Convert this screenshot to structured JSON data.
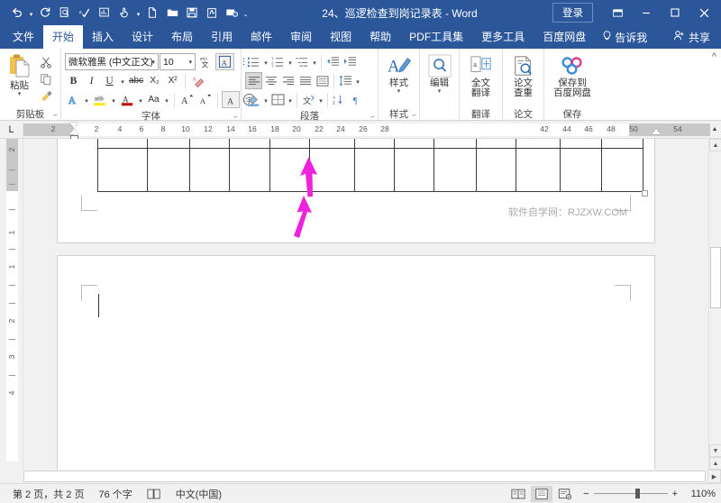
{
  "titlebar": {
    "document_title": "24、巡逻检查到岗记录表  -  Word",
    "signin_label": "登录",
    "quick_access": [
      {
        "name": "undo-icon",
        "glyph": "↶"
      },
      {
        "name": "redo-icon",
        "glyph": "↻"
      },
      {
        "name": "print-preview-icon",
        "glyph": "▣"
      },
      {
        "name": "spelling-check-icon",
        "glyph": "✓"
      },
      {
        "name": "chart-edit-icon",
        "glyph": "▤"
      },
      {
        "name": "touch-mode-icon",
        "glyph": "☝"
      },
      {
        "name": "new-document-icon",
        "glyph": "🗋"
      },
      {
        "name": "open-folder-icon",
        "glyph": "🗀"
      },
      {
        "name": "save-icon",
        "glyph": "🖫"
      },
      {
        "name": "signature-icon",
        "glyph": "🖎"
      },
      {
        "name": "email-icon",
        "glyph": "🖃"
      },
      {
        "name": "customize-qat-icon",
        "glyph": "⌄"
      }
    ],
    "window_controls": {
      "ribbon_display": "▭",
      "minimize": "—",
      "maximize": "▢",
      "close": "✕"
    }
  },
  "tabs": [
    {
      "id": "file",
      "label": "文件"
    },
    {
      "id": "home",
      "label": "开始"
    },
    {
      "id": "insert",
      "label": "插入"
    },
    {
      "id": "design",
      "label": "设计"
    },
    {
      "id": "layout",
      "label": "布局"
    },
    {
      "id": "references",
      "label": "引用"
    },
    {
      "id": "mailings",
      "label": "邮件"
    },
    {
      "id": "review",
      "label": "审阅"
    },
    {
      "id": "view",
      "label": "视图"
    },
    {
      "id": "help",
      "label": "帮助"
    },
    {
      "id": "pdf-tools",
      "label": "PDF工具集"
    },
    {
      "id": "more-tools",
      "label": "更多工具"
    },
    {
      "id": "baidu-netdisk",
      "label": "百度网盘"
    }
  ],
  "active_tab": "开始",
  "tell_me": "告诉我",
  "share": "共享",
  "ribbon": {
    "clipboard": {
      "group_label": "剪贴板",
      "paste_label": "粘贴",
      "cut_label": "剪切",
      "copy_label": "复制",
      "format_painter_label": "格式刷"
    },
    "font": {
      "group_label": "字体",
      "font_name": "微软雅黑 (中文正文)",
      "font_size": "10",
      "bold": "B",
      "italic": "I",
      "underline": "U",
      "strikethrough": "abc",
      "subscript": "X₂",
      "superscript": "X²",
      "clear_format": "清除所有格式",
      "text_effects": "A",
      "highlight": "ab",
      "font_color": "A",
      "change_case": "Aa",
      "grow_font": "A",
      "shrink_font": "A",
      "char_border": "A",
      "phonetic_guide": "字"
    },
    "paragraph": {
      "group_label": "段落",
      "bullets": "≔",
      "numbering": "≕",
      "multilevel": "≖",
      "decrease_indent": "⇤",
      "increase_indent": "⇥",
      "align_left": "≡",
      "align_center": "≡",
      "align_right": "≡",
      "justify": "≡",
      "distribute": "▤",
      "line_spacing": "↕",
      "shading": "▲",
      "borders": "⊞",
      "sort": "↓",
      "show_marks": "¶",
      "cjk_layout": "文"
    },
    "styles": {
      "group_label": "样式",
      "button_label": "样式"
    },
    "editing": {
      "group_label": "",
      "button_label": "编辑"
    },
    "translate": {
      "group_label": "翻译",
      "button_label_line1": "全文",
      "button_label_line2": "翻译"
    },
    "paper": {
      "group_label": "论文",
      "button_label_line1": "论文",
      "button_label_line2": "查重"
    },
    "save_cloud": {
      "group_label": "保存",
      "button_label_line1": "保存到",
      "button_label_line2": "百度网盘"
    }
  },
  "ruler": {
    "tabstop_marker": "L",
    "horizontal_ticks": [
      "2",
      "2",
      "4",
      "6",
      "8",
      "10",
      "12",
      "14",
      "16",
      "18",
      "20",
      "22",
      "24",
      "26",
      "28",
      "42",
      "44",
      "46",
      "48",
      "50",
      "54"
    ],
    "vertical_ticks": [
      "2",
      "1",
      "1",
      "2",
      "3",
      "4"
    ]
  },
  "document": {
    "watermark": "软件自学网：RJZXW.COM",
    "table": {
      "columns": 13,
      "rows": 2
    },
    "annotations": [
      {
        "name": "magenta-arrow-upper",
        "color": "#ee22dd",
        "points": "up"
      },
      {
        "name": "magenta-arrow-lower",
        "color": "#ee22dd",
        "points": "up"
      }
    ]
  },
  "statusbar": {
    "page_info": "第 2 页，共 2 页",
    "word_count": "76 个字",
    "proofing_icon": "📖",
    "language": "中文(中国)",
    "views": [
      {
        "name": "read-mode",
        "glyph": "▥",
        "active": false
      },
      {
        "name": "print-layout",
        "glyph": "▤",
        "active": true
      },
      {
        "name": "web-layout",
        "glyph": "▣",
        "active": false
      }
    ],
    "zoom_out": "−",
    "zoom_in": "+",
    "zoom_level": "110%",
    "zoom_value": 110
  },
  "colors": {
    "brand_blue": "#2b579a",
    "accent_magenta": "#ee22dd",
    "chrome_gray": "#f1f1f1"
  }
}
